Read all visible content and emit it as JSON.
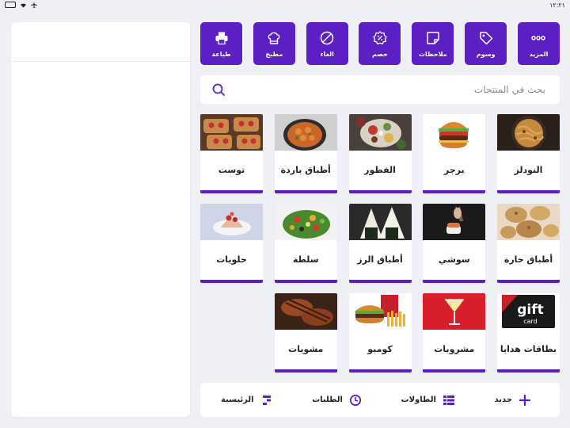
{
  "status": {
    "time": "١٢:٢١"
  },
  "toolbar": [
    {
      "label": "المزيد",
      "icon": "more-icon"
    },
    {
      "label": "وسوم",
      "icon": "tag-icon"
    },
    {
      "label": "ملاحظات",
      "icon": "note-icon"
    },
    {
      "label": "خصم",
      "icon": "discount-icon"
    },
    {
      "label": "الغاء",
      "icon": "cancel-icon"
    },
    {
      "label": "مطبخ",
      "icon": "chef-hat-icon"
    },
    {
      "label": "طباعة",
      "icon": "printer-icon"
    }
  ],
  "search": {
    "placeholder": "بحث في المنتجات"
  },
  "categories": [
    {
      "name": "النودلز",
      "image": "noodles-image"
    },
    {
      "name": "برجر",
      "image": "burger-image"
    },
    {
      "name": "الفطور",
      "image": "breakfast-image"
    },
    {
      "name": "أطباق باردة",
      "image": "cold-dishes-image"
    },
    {
      "name": "توست",
      "image": "toast-image"
    },
    {
      "name": "أطباق حارة",
      "image": "hot-dishes-image"
    },
    {
      "name": "سوشي",
      "image": "sushi-image"
    },
    {
      "name": "أطباق الرز",
      "image": "rice-dishes-image"
    },
    {
      "name": "سلطة",
      "image": "salad-image"
    },
    {
      "name": "حلويات",
      "image": "desserts-image"
    },
    {
      "name": "بطاقات هدايا",
      "image": "gift-card-image",
      "image_text": [
        "gift",
        "card"
      ]
    },
    {
      "name": "مشروبات",
      "image": "drinks-image"
    },
    {
      "name": "كومبو",
      "image": "combo-image"
    },
    {
      "name": "مشويات",
      "image": "grills-image"
    }
  ],
  "bottomnav": {
    "new": "جديد",
    "tables": "الطاولات",
    "orders": "الطلبات",
    "home": "الرئيسية"
  },
  "colors": {
    "accent": "#5b1fc4",
    "background": "#eef0f6"
  }
}
